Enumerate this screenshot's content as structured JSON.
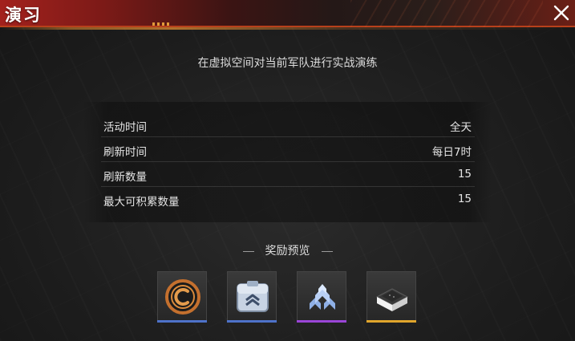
{
  "header": {
    "title": "演习"
  },
  "subtitle": "在虚拟空间对当前军队进行实战演练",
  "info_rows": [
    {
      "label": "活动时间",
      "value": "全天"
    },
    {
      "label": "刷新时间",
      "value": "每日7时"
    },
    {
      "label": "刷新数量",
      "value": "15"
    },
    {
      "label": "最大可积累数量",
      "value": "15"
    }
  ],
  "rewards": {
    "heading": "奖励预览",
    "items": [
      {
        "icon": "coin-icon",
        "rarity_color": "#4e72c9"
      },
      {
        "icon": "supply-chest-icon",
        "rarity_color": "#4e72c9"
      },
      {
        "icon": "rank-chevrons-icon",
        "rarity_color": "#9a45d6"
      },
      {
        "icon": "material-block-icon",
        "rarity_color": "#e0a52c"
      }
    ]
  },
  "colors": {
    "header_red": "#a3211d",
    "accent_orange": "#b8401b"
  }
}
